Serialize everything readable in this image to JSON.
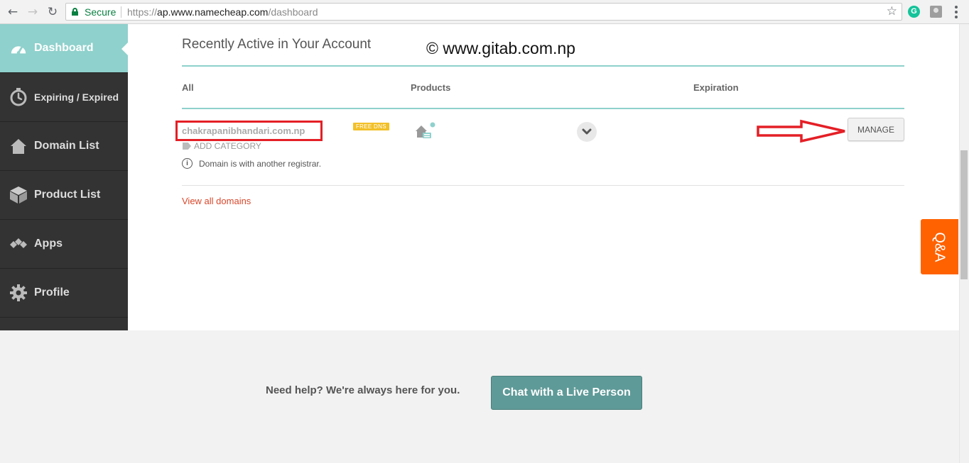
{
  "browser": {
    "secure_label": "Secure",
    "url_prefix": "https://",
    "url_host": "ap.www.namecheap.com",
    "url_path": "/dashboard",
    "extension_badge": "G"
  },
  "sidebar": {
    "items": [
      {
        "label": "Dashboard",
        "icon": "speedometer-icon",
        "active": true
      },
      {
        "label": "Expiring / Expired",
        "icon": "timer-icon"
      },
      {
        "label": "Domain List",
        "icon": "home-icon"
      },
      {
        "label": "Product List",
        "icon": "box-icon"
      },
      {
        "label": "Apps",
        "icon": "apps-diamonds-icon"
      },
      {
        "label": "Profile",
        "icon": "gear-icon"
      }
    ]
  },
  "main": {
    "section_title": "Recently Active in Your Account",
    "watermark": "© www.gitab.com.np",
    "columns": {
      "all": "All",
      "products": "Products",
      "expiration": "Expiration"
    },
    "row": {
      "domain": "chakrapanibhandari.com.np",
      "badge": "FREE DNS",
      "add_category": "ADD CATEGORY",
      "info": "Domain is with another registrar.",
      "manage": "MANAGE"
    },
    "view_all": "View all domains"
  },
  "qa_tab": "Q&A",
  "footer": {
    "help_text": "Need help? We're always here for you.",
    "chat_button": "Chat with a Live Person"
  },
  "colors": {
    "accent_teal": "#8fd1cc",
    "sidebar_bg": "#333333",
    "qa_orange": "#ff6200",
    "annotation_red": "#e41f26",
    "link_red": "#d9472b"
  }
}
